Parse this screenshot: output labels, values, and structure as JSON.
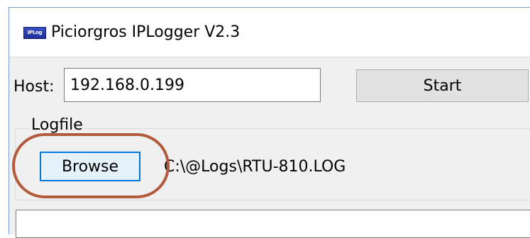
{
  "window": {
    "title": "Piciorgros IPLogger V2.3",
    "icon": {
      "name": "iplogger-app-icon",
      "text": "IPLog",
      "color": "#2a3cb4"
    }
  },
  "host": {
    "label": "Host:",
    "value": "192.168.0.199"
  },
  "start_button": {
    "label": "Start"
  },
  "logfile": {
    "group_label": "Logfile",
    "browse_label": "Browse",
    "path": "C:\\@Logs\\RTU-810.LOG"
  },
  "annotation": {
    "highlight_color": "#b35a3d"
  },
  "colors": {
    "focus_accent": "#0078d7",
    "window_border": "#7aa0d6"
  }
}
